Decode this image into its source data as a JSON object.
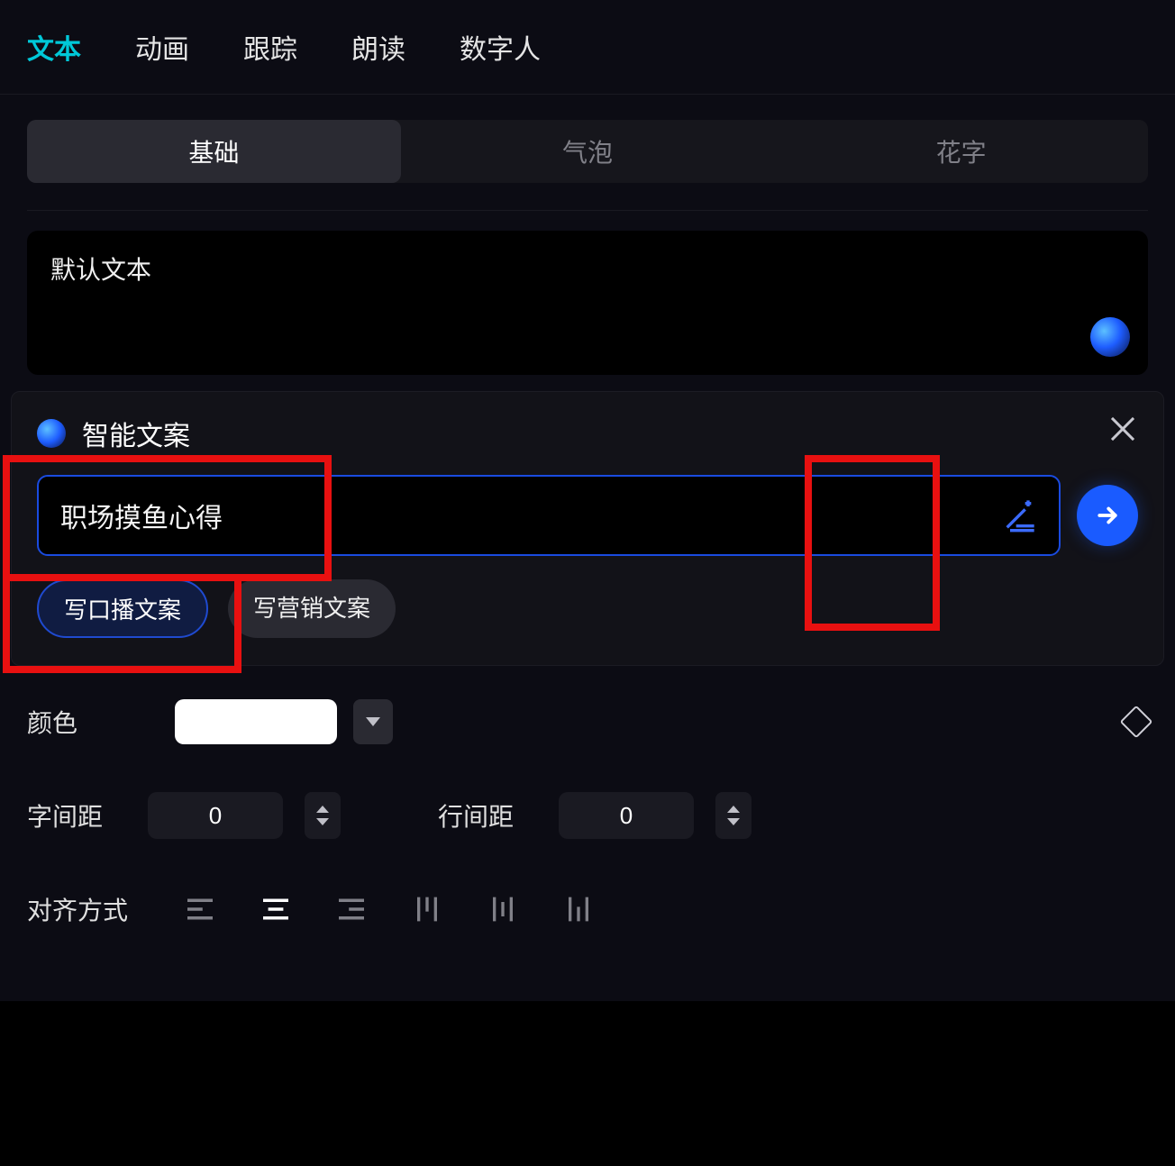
{
  "top_tabs": {
    "items": [
      {
        "label": "文本"
      },
      {
        "label": "动画"
      },
      {
        "label": "跟踪"
      },
      {
        "label": "朗读"
      },
      {
        "label": "数字人"
      }
    ],
    "active": 0
  },
  "sub_tabs": {
    "items": [
      {
        "label": "基础"
      },
      {
        "label": "气泡"
      },
      {
        "label": "花字"
      }
    ],
    "active": 0
  },
  "text_box": {
    "value": "默认文本"
  },
  "ai_panel": {
    "title": "智能文案",
    "input_value": "职场摸鱼心得",
    "chips": [
      {
        "label": "写口播文案"
      },
      {
        "label": "写营销文案"
      }
    ],
    "chip_active": 0
  },
  "controls": {
    "color_label": "颜色",
    "color_value": "#ffffff",
    "letter_spacing_label": "字间距",
    "letter_spacing_value": "0",
    "line_spacing_label": "行间距",
    "line_spacing_value": "0",
    "align_label": "对齐方式"
  }
}
